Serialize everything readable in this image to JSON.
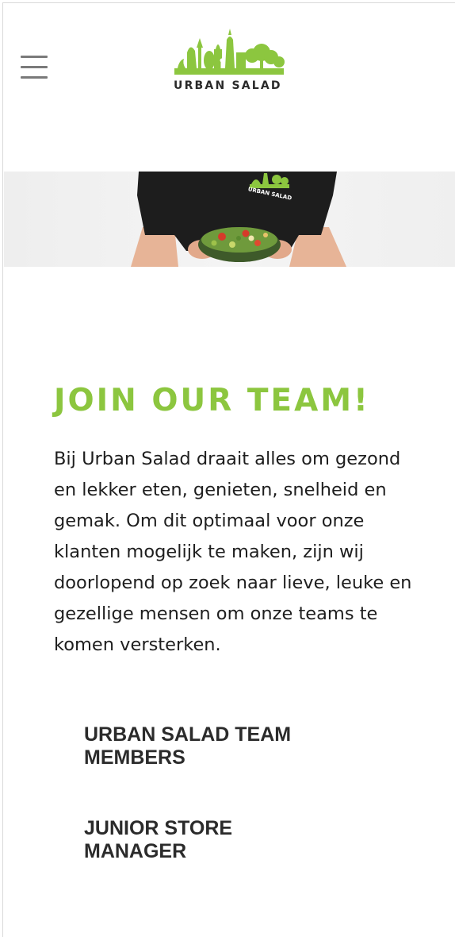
{
  "header": {
    "menu_icon": "hamburger-menu-icon",
    "logo_text": "URBAN SALAD"
  },
  "hero": {
    "description": "person-holding-salad-bowl-photo"
  },
  "main": {
    "heading": "JOIN OUR TEAM!",
    "intro": "Bij Urban Salad draait alles om gezond en lekker eten, genieten, snelheid en gemak. Om dit optimaal voor onze klanten mogelijk te maken, zijn wij doorlopend op zoek naar lieve, leuke en gezellige mensen om onze teams te komen versterken."
  },
  "jobs": [
    {
      "title": "URBAN SALAD TEAM MEMBERS"
    },
    {
      "title": "JUNIOR STORE MANAGER"
    }
  ],
  "colors": {
    "brand_green": "#8cc63f",
    "text_dark": "#1e1e1e",
    "link_dark": "#2b2b2b"
  }
}
